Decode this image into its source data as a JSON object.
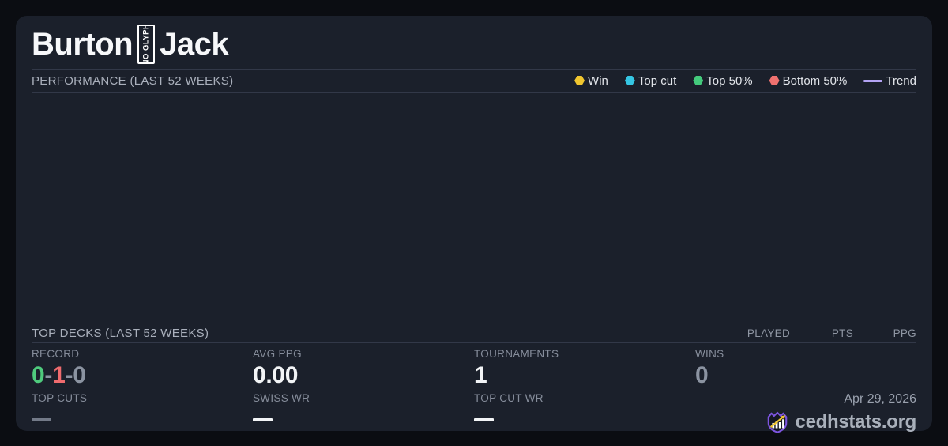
{
  "title": {
    "first": "Burton",
    "noglyph_text": "NO GLYPH",
    "last": "Jack"
  },
  "performance": {
    "heading": "PERFORMANCE (LAST 52 WEEKS)",
    "legend": [
      {
        "label": "Win",
        "color": "#f0c62f"
      },
      {
        "label": "Top cut",
        "color": "#35c6e3"
      },
      {
        "label": "Top 50%",
        "color": "#44ca7c"
      },
      {
        "label": "Bottom 50%",
        "color": "#f0716f"
      }
    ],
    "trend": {
      "label": "Trend",
      "color": "#b4a4f4"
    }
  },
  "top_decks": {
    "heading": "TOP DECKS (LAST 52 WEEKS)",
    "columns": [
      "PLAYED",
      "PTS",
      "PPG"
    ]
  },
  "stats": {
    "record": {
      "label": "RECORD",
      "wins": "0",
      "losses": "1",
      "draws": "0",
      "separator": "-"
    },
    "avg_ppg": {
      "label": "AVG PPG",
      "value": "0.00"
    },
    "tournaments": {
      "label": "TOURNAMENTS",
      "value": "1"
    },
    "wins": {
      "label": "WINS",
      "value": "0"
    },
    "top_cuts": {
      "label": "TOP CUTS",
      "value": "—"
    },
    "swiss_wr": {
      "label": "SWISS WR",
      "value": "—"
    },
    "top_cut_wr": {
      "label": "TOP CUT WR",
      "value": "—"
    }
  },
  "footer": {
    "date": "Apr 29, 2026",
    "site": "cedhstats.org"
  },
  "colors": {
    "background": "#0b0d12",
    "card": "#1b202b",
    "record_win_green": "#4fcb7d",
    "record_loss_red": "#ef6b6e",
    "muted_value_gray": "#8b93a1",
    "brand_purple": "#7d55e0",
    "brand_arrow_yellow": "#f0c62f"
  }
}
